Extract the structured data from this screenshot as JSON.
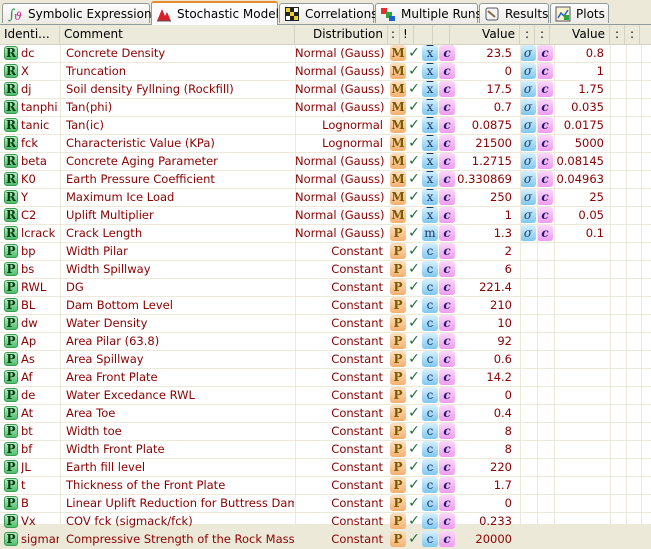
{
  "tabs": [
    {
      "label": "Symbolic Expressions",
      "icon": "integral-icon",
      "active": false
    },
    {
      "label": "Stochastic Model",
      "icon": "distribution-icon",
      "active": true
    },
    {
      "label": "Correlations",
      "icon": "matrix-icon",
      "active": false
    },
    {
      "label": "Multiple Runs",
      "icon": "cubes-icon",
      "active": false
    },
    {
      "label": "Results",
      "icon": "notebook-icon",
      "active": false
    },
    {
      "label": "Plots",
      "icon": "plot-icon",
      "active": false
    }
  ],
  "columns": {
    "identifier": "Identi...",
    "comment": "Comment",
    "distribution": "Distribution",
    "c1": ":",
    "c2": "!",
    "value": "Value",
    "s1": ":",
    "s2": ":",
    "value2": "Value",
    "s3": ":",
    "s4": ":"
  },
  "colors": {
    "text": "#8b0000",
    "badge_green": "#4fbf6b",
    "dist_btn": "#f5b070",
    "blue_btn": "#7fc8ef",
    "pink_btn": "#ee9cee",
    "active_tab_accent": "#e68b2c"
  },
  "rows": [
    {
      "type": "R",
      "id": "dc",
      "comment": "Concrete Density",
      "dist": "Normal (Gauss)",
      "dist_btn": "M",
      "b1": "x̄",
      "b2": "c",
      "value": "23.5",
      "s1": "σ",
      "s2": "c",
      "value2": "0.8"
    },
    {
      "type": "R",
      "id": "X",
      "comment": "Truncation",
      "dist": "Normal (Gauss)",
      "dist_btn": "M",
      "b1": "x̄",
      "b2": "c",
      "value": "0",
      "s1": "σ",
      "s2": "c",
      "value2": "1"
    },
    {
      "type": "R",
      "id": "dj",
      "comment": "Soil density Fyllning (Rockfill)",
      "dist": "Normal (Gauss)",
      "dist_btn": "M",
      "b1": "x̄",
      "b2": "c",
      "value": "17.5",
      "s1": "σ",
      "s2": "c",
      "value2": "1.75"
    },
    {
      "type": "R",
      "id": "tanphi",
      "comment": "Tan(phi)",
      "dist": "Normal (Gauss)",
      "dist_btn": "M",
      "b1": "x̄",
      "b2": "c",
      "value": "0.7",
      "s1": "σ",
      "s2": "c",
      "value2": "0.035"
    },
    {
      "type": "R",
      "id": "tanic",
      "comment": "Tan(ic)",
      "dist": "Lognormal",
      "dist_btn": "M",
      "b1": "x̄",
      "b2": "c",
      "value": "0.0875",
      "s1": "σ",
      "s2": "c",
      "value2": "0.0175"
    },
    {
      "type": "R",
      "id": "fck",
      "comment": "Characteristic Value (KPa)",
      "dist": "Lognormal",
      "dist_btn": "M",
      "b1": "x̄",
      "b2": "c",
      "value": "21500",
      "s1": "σ",
      "s2": "c",
      "value2": "5000"
    },
    {
      "type": "R",
      "id": "beta",
      "comment": "Concrete Aging Parameter",
      "dist": "Normal (Gauss)",
      "dist_btn": "M",
      "b1": "x̄",
      "b2": "c",
      "value": "1.2715",
      "s1": "σ",
      "s2": "c",
      "value2": "0.08145"
    },
    {
      "type": "R",
      "id": "K0",
      "comment": "Earth Pressure Coefficient",
      "dist": "Normal (Gauss)",
      "dist_btn": "M",
      "b1": "x̄",
      "b2": "c",
      "value": "0.330869",
      "s1": "σ",
      "s2": "c",
      "value2": "0.04963"
    },
    {
      "type": "R",
      "id": "Y",
      "comment": "Maximum Ice Load",
      "dist": "Normal (Gauss)",
      "dist_btn": "M",
      "b1": "x̄",
      "b2": "c",
      "value": "250",
      "s1": "σ",
      "s2": "c",
      "value2": "25"
    },
    {
      "type": "R",
      "id": "C2",
      "comment": "Uplift Multiplier",
      "dist": "Normal (Gauss)",
      "dist_btn": "M",
      "b1": "x̄",
      "b2": "c",
      "value": "1",
      "s1": "σ",
      "s2": "c",
      "value2": "0.05"
    },
    {
      "type": "R",
      "id": "lcrack",
      "comment": "Crack Length",
      "dist": "Normal (Gauss)",
      "dist_btn": "P",
      "b1": "m",
      "b2": "c",
      "value": "1.3",
      "s1": "σ",
      "s2": "c",
      "value2": "0.1"
    },
    {
      "type": "P",
      "id": "bp",
      "comment": "Width Pilar",
      "dist": "Constant",
      "dist_btn": "P",
      "b1": "c",
      "b2": "c",
      "value": "2"
    },
    {
      "type": "P",
      "id": "bs",
      "comment": "Width Spillway",
      "dist": "Constant",
      "dist_btn": "P",
      "b1": "c",
      "b2": "c",
      "value": "6"
    },
    {
      "type": "P",
      "id": "RWL",
      "comment": "DG",
      "dist": "Constant",
      "dist_btn": "P",
      "b1": "c",
      "b2": "c",
      "value": "221.4"
    },
    {
      "type": "P",
      "id": "BL",
      "comment": "Dam Bottom Level",
      "dist": "Constant",
      "dist_btn": "P",
      "b1": "c",
      "b2": "c",
      "value": "210"
    },
    {
      "type": "P",
      "id": "dw",
      "comment": "Water Density",
      "dist": "Constant",
      "dist_btn": "P",
      "b1": "c",
      "b2": "c",
      "value": "10"
    },
    {
      "type": "P",
      "id": "Ap",
      "comment": "Area Pilar (63.8)",
      "dist": "Constant",
      "dist_btn": "P",
      "b1": "c",
      "b2": "c",
      "value": "92"
    },
    {
      "type": "P",
      "id": "As",
      "comment": "Area Spillway",
      "dist": "Constant",
      "dist_btn": "P",
      "b1": "c",
      "b2": "c",
      "value": "0.6"
    },
    {
      "type": "P",
      "id": "Af",
      "comment": "Area Front Plate",
      "dist": "Constant",
      "dist_btn": "P",
      "b1": "c",
      "b2": "c",
      "value": "14.2"
    },
    {
      "type": "P",
      "id": "de",
      "comment": "Water Excedance RWL",
      "dist": "Constant",
      "dist_btn": "P",
      "b1": "c",
      "b2": "c",
      "value": "0"
    },
    {
      "type": "P",
      "id": "At",
      "comment": "Area Toe",
      "dist": "Constant",
      "dist_btn": "P",
      "b1": "c",
      "b2": "c",
      "value": "0.4"
    },
    {
      "type": "P",
      "id": "bt",
      "comment": "Width toe",
      "dist": "Constant",
      "dist_btn": "P",
      "b1": "c",
      "b2": "c",
      "value": "8"
    },
    {
      "type": "P",
      "id": "bf",
      "comment": "Width Front Plate",
      "dist": "Constant",
      "dist_btn": "P",
      "b1": "c",
      "b2": "c",
      "value": "8"
    },
    {
      "type": "P",
      "id": "JL",
      "comment": "Earth fill level",
      "dist": "Constant",
      "dist_btn": "P",
      "b1": "c",
      "b2": "c",
      "value": "220"
    },
    {
      "type": "P",
      "id": "t",
      "comment": "Thickness of the Front Plate",
      "dist": "Constant",
      "dist_btn": "P",
      "b1": "c",
      "b2": "c",
      "value": "1.7"
    },
    {
      "type": "P",
      "id": "B",
      "comment": "Linear Uplift Reduction for Buttress Dams",
      "dist": "Constant",
      "dist_btn": "P",
      "b1": "c",
      "b2": "c",
      "value": "0"
    },
    {
      "type": "P",
      "id": "Vx",
      "comment": "COV fck (sigmack/fck)",
      "dist": "Constant",
      "dist_btn": "P",
      "b1": "c",
      "b2": "c",
      "value": "0.233"
    },
    {
      "type": "P",
      "id": "sigmar",
      "comment": "Compressive Strength of the Rock Mass",
      "dist": "Constant",
      "dist_btn": "P",
      "b1": "c",
      "b2": "c",
      "value": "20000"
    }
  ]
}
